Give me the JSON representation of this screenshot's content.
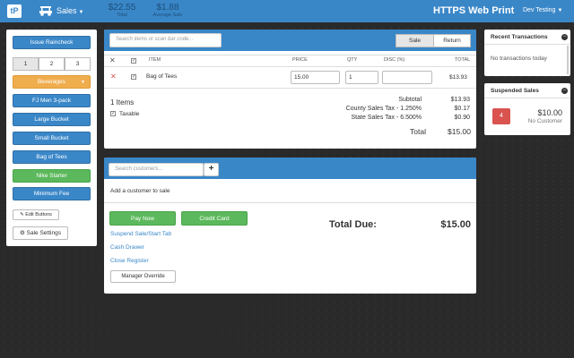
{
  "nav": {
    "logo_text": "tP",
    "sales_label": "Sales",
    "total_value": "$22.55",
    "total_label": "Total",
    "avg_value": "$1.88",
    "avg_label": "Average Sale",
    "title": "HTTPS Web Print",
    "user": "Dev Testing"
  },
  "left": {
    "issue_label": "Issue Raincheck",
    "pages": [
      "1",
      "2",
      "3"
    ],
    "category_label": "Beverages",
    "items": [
      "FJ Men 3-pack",
      "Large Bucket",
      "Small Bucket",
      "Bag of Tees",
      "Nike Starter",
      "Minimum Fee"
    ],
    "edit_label": "Edit Buttons",
    "settings_label": "Sale Settings"
  },
  "cart": {
    "search_placeholder": "Search items or scan bar code...",
    "tab_sale": "Sale",
    "tab_return": "Return",
    "headers": {
      "item": "ITEM",
      "price": "PRICE",
      "qty": "QTY",
      "disc": "DISC (%)",
      "total": "TOTAL"
    },
    "row": {
      "name": "Bag of Tees",
      "price": "15.00",
      "qty": "1",
      "disc": "",
      "total": "$13.93"
    },
    "items_count": "1 Items",
    "taxable_label": "Taxable",
    "subtotal_label": "Subtotal",
    "subtotal_value": "$13.93",
    "county_label": "County Sales Tax - 1.250%",
    "county_value": "$0.17",
    "state_label": "State Sales Tax - 6.500%",
    "state_value": "$0.90",
    "total_label": "Total",
    "total_value": "$15.00"
  },
  "customer": {
    "search_placeholder": "Search customers...",
    "add_text": "Add a customer to sale",
    "pay_now": "Pay Now",
    "credit_card": "Credit Card",
    "link_suspend": "Suspend Sale/Start Tab",
    "link_drawer": "Cash Drawer",
    "link_close": "Close Register",
    "manager_override": "Manager Override",
    "total_due_label": "Total Due:",
    "total_due_value": "$15.00"
  },
  "recent": {
    "title": "Recent Transactions",
    "empty": "No transactions today"
  },
  "suspended": {
    "title": "Suspended Sales",
    "badge": "4",
    "amount": "$10.00",
    "customer": "No Customer"
  },
  "colors": {
    "primary": "#3a87c8",
    "orange": "#f0ad4e",
    "green": "#5cb85c",
    "danger": "#d9534f"
  }
}
